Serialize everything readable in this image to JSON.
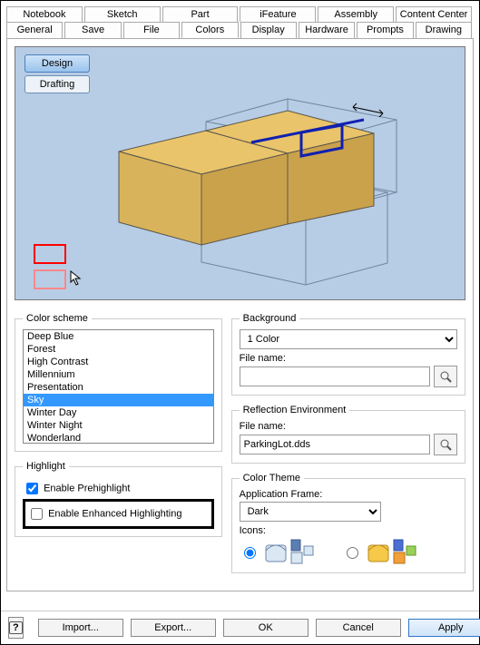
{
  "tabs_row1": [
    "Notebook",
    "Sketch",
    "Part",
    "iFeature",
    "Assembly",
    "Content Center"
  ],
  "tabs_row2": [
    "General",
    "Save",
    "File",
    "Colors",
    "Display",
    "Hardware",
    "Prompts",
    "Drawing"
  ],
  "active_tab": "Colors",
  "preview": {
    "design_label": "Design",
    "drafting_label": "Drafting"
  },
  "color_scheme": {
    "legend": "Color scheme",
    "items": [
      "Deep Blue",
      "Forest",
      "High Contrast",
      "Millennium",
      "Presentation",
      "Sky",
      "Winter Day",
      "Winter Night",
      "Wonderland"
    ],
    "selected": "Sky"
  },
  "highlight": {
    "legend": "Highlight",
    "prehighlight_label": "Enable Prehighlight",
    "enhanced_label": "Enable Enhanced Highlighting"
  },
  "background": {
    "legend": "Background",
    "option": "1 Color",
    "filename_label": "File name:",
    "filename_value": ""
  },
  "reflection": {
    "legend": "Reflection Environment",
    "filename_label": "File name:",
    "filename_value": "ParkingLot.dds"
  },
  "color_theme": {
    "legend": "Color Theme",
    "app_frame_label": "Application Frame:",
    "app_frame_value": "Dark",
    "icons_label": "Icons:"
  },
  "footer": {
    "import": "Import...",
    "export": "Export...",
    "ok": "OK",
    "cancel": "Cancel",
    "apply": "Apply",
    "help": "?"
  }
}
